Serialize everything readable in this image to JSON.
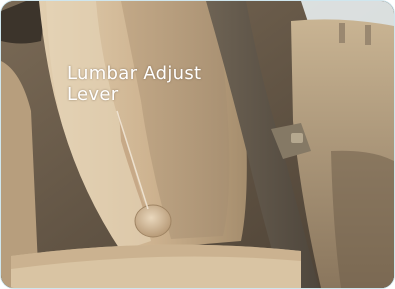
{
  "image": {
    "subject": "car-seat-photo",
    "accent_color": "#cfe6ee",
    "upholstery_color": "#cdb28f"
  },
  "callout": {
    "line1": "Lumbar Adjust",
    "line2": "Lever"
  }
}
